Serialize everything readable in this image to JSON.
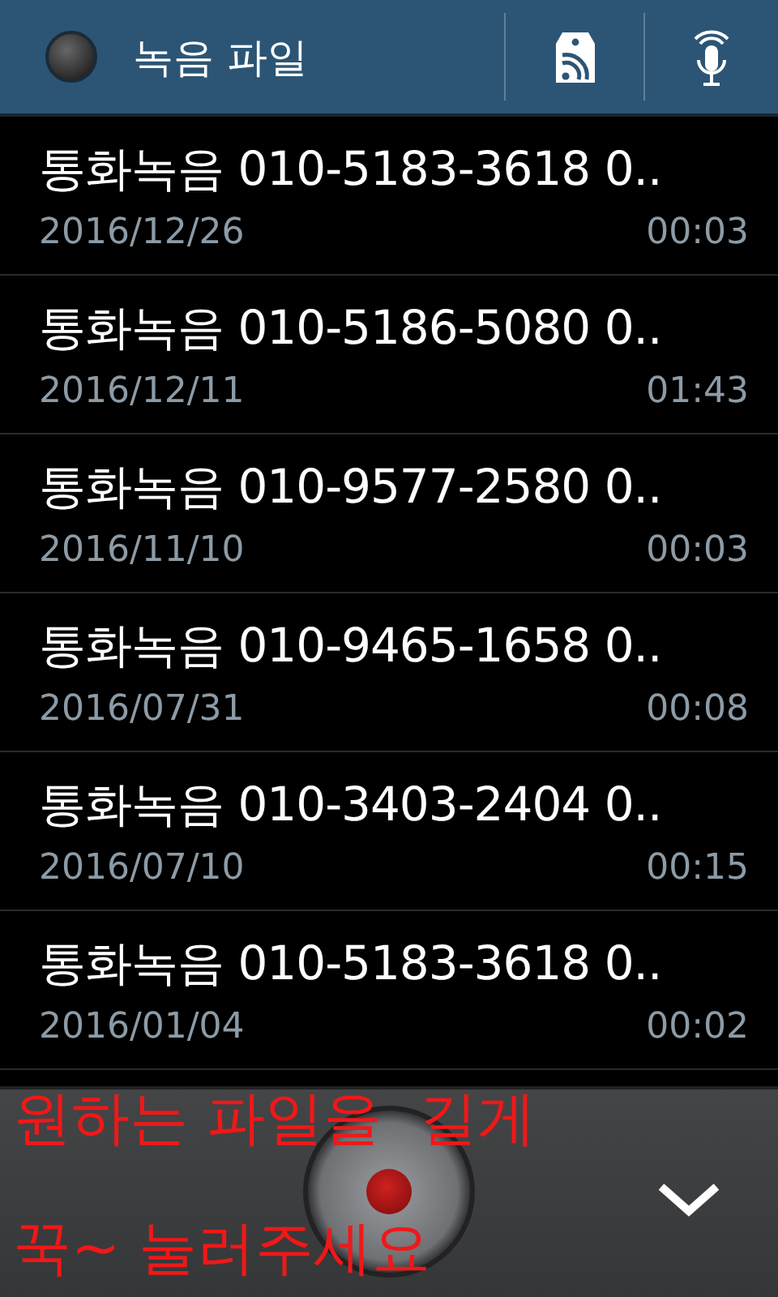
{
  "header": {
    "title": "녹음 파일"
  },
  "recordings": [
    {
      "name": "통화녹음 010-5183-3618 0..",
      "date": "2016/12/26",
      "duration": "00:03"
    },
    {
      "name": "통화녹음 010-5186-5080 0..",
      "date": "2016/12/11",
      "duration": "01:43"
    },
    {
      "name": "통화녹음 010-9577-2580 0..",
      "date": "2016/11/10",
      "duration": "00:03"
    },
    {
      "name": "통화녹음 010-9465-1658 0..",
      "date": "2016/07/31",
      "duration": "00:08"
    },
    {
      "name": "통화녹음 010-3403-2404 0..",
      "date": "2016/07/10",
      "duration": "00:15"
    },
    {
      "name": "통화녹음 010-5183-3618 0..",
      "date": "2016/01/04",
      "duration": "00:02"
    }
  ],
  "annotation": [
    "원하는 파일을  길게",
    "꾹~ 눌러주세요"
  ]
}
